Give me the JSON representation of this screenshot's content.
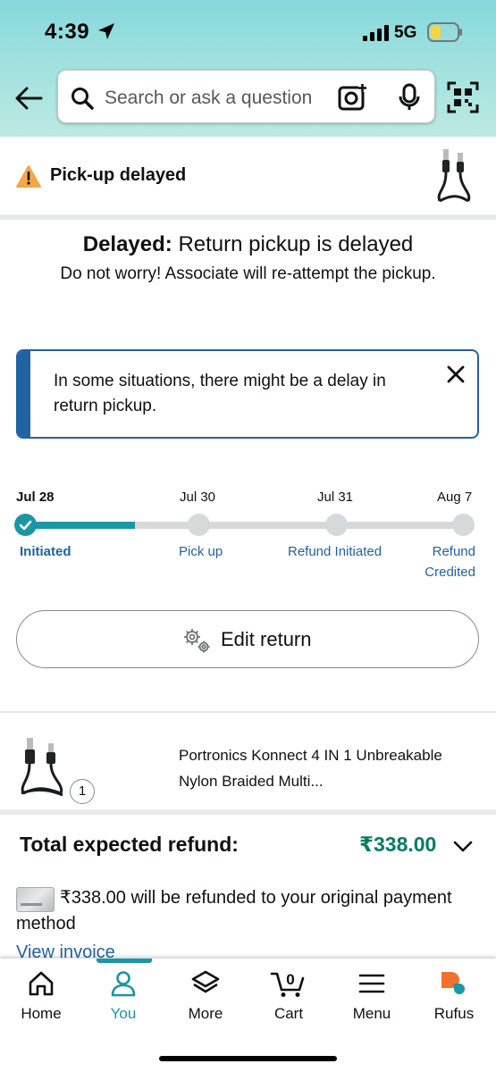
{
  "status_bar": {
    "time": "4:39",
    "network": "5G"
  },
  "search": {
    "placeholder": "Search or ask a question"
  },
  "status": {
    "title": "Pick-up delayed"
  },
  "delay": {
    "title_bold": "Delayed:",
    "title_rest": " Return pickup is delayed",
    "subtitle": "Do not worry! Associate will re-attempt the pickup."
  },
  "info_box": {
    "text": "In some situations, there might be a delay in return pickup."
  },
  "tracker": {
    "progress": 0.25,
    "steps": [
      {
        "date": "Jul 28",
        "label": "Initiated",
        "done": true
      },
      {
        "date": "Jul 30",
        "label": "Pick up",
        "done": false
      },
      {
        "date": "Jul 31",
        "label": "Refund Initiated",
        "done": false
      },
      {
        "date": "Aug 7",
        "label": "Refund Credited",
        "done": false
      }
    ]
  },
  "edit_button": {
    "label": "Edit return"
  },
  "product": {
    "name": "Portronics Konnect 4 IN 1 Unbreakable Nylon Braided Multi...",
    "quantity": "1"
  },
  "refund": {
    "label": "Total expected refund:",
    "amount": "₹338.00",
    "note": "₹338.00 will be refunded to your original payment method",
    "view_invoice": "View invoice"
  },
  "tabs": [
    {
      "label": "Home",
      "icon": "home-icon",
      "active": false
    },
    {
      "label": "You",
      "icon": "person-icon",
      "active": true
    },
    {
      "label": "More",
      "icon": "layers-icon",
      "active": false
    },
    {
      "label": "Cart",
      "icon": "cart-icon",
      "active": false,
      "badge": "0"
    },
    {
      "label": "Menu",
      "icon": "menu-icon",
      "active": false
    },
    {
      "label": "Rufus",
      "icon": "rufus-icon",
      "active": false
    }
  ],
  "colors": {
    "accent_teal": "#1c96a4",
    "link_blue": "#2162a1",
    "refund_green": "#067d62",
    "warning_orange": "#f3a847",
    "header_teal": "#86d8dc"
  }
}
